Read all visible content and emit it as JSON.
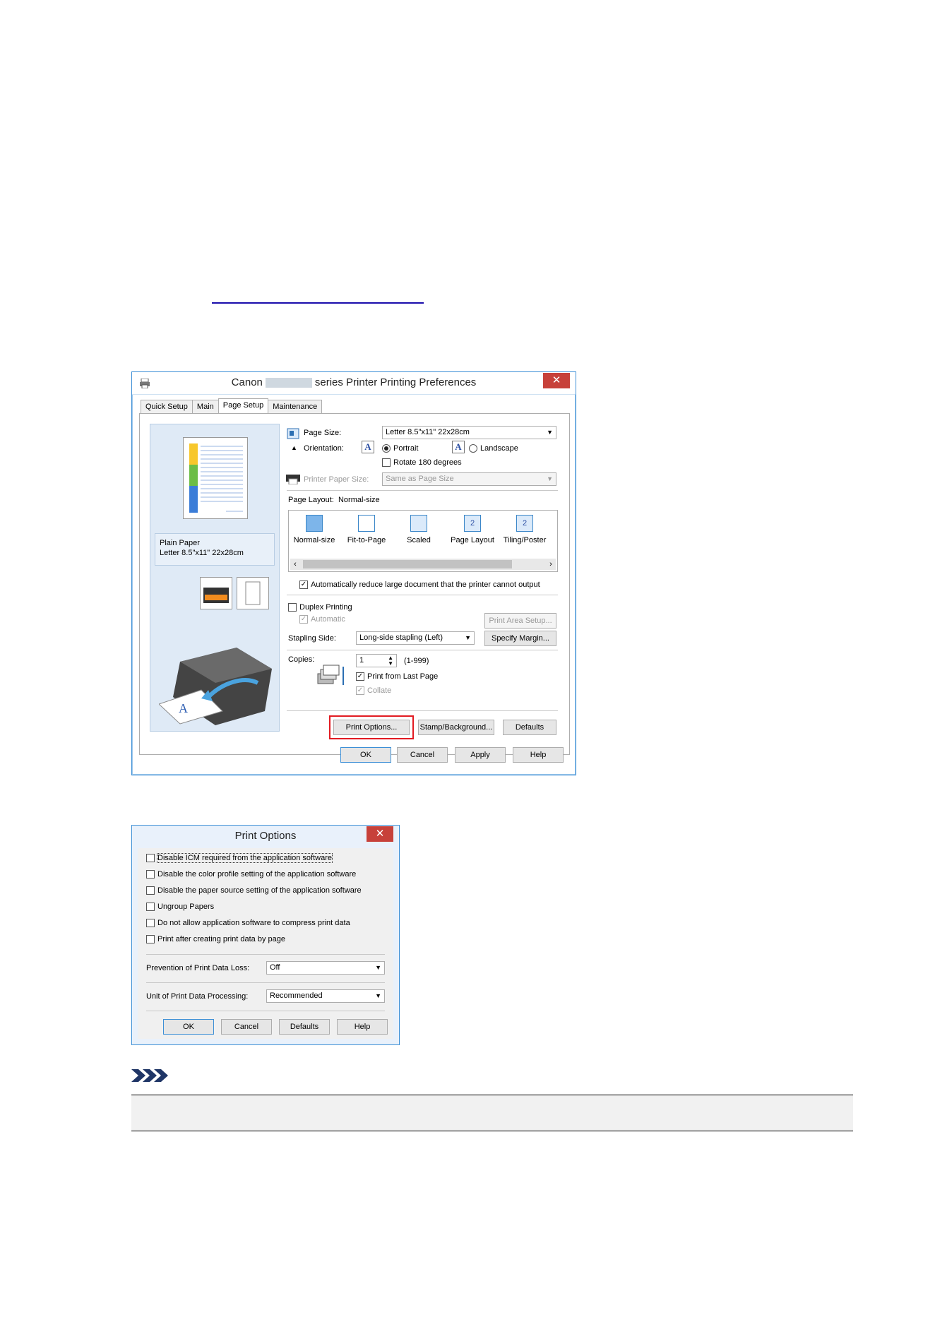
{
  "doc_link": "",
  "dialog1": {
    "title_prefix": "Canon",
    "title_suffix": "series Printer Printing Preferences",
    "close": "✕",
    "tabs": [
      "Quick Setup",
      "Main",
      "Page Setup",
      "Maintenance"
    ],
    "page_size_label": "Page Size:",
    "page_size_value": "Letter 8.5\"x11\" 22x28cm",
    "orientation_label": "Orientation:",
    "portrait": "Portrait",
    "landscape": "Landscape",
    "rotate": "Rotate 180 degrees",
    "printer_paper_size_label": "Printer Paper Size:",
    "printer_paper_size_value": "Same as Page Size",
    "page_layout_label": "Page Layout:",
    "page_layout_value": "Normal-size",
    "layouts": [
      "Normal-size",
      "Fit-to-Page",
      "Scaled",
      "Page Layout",
      "Tiling/Poster"
    ],
    "auto_reduce": "Automatically reduce large document that the printer cannot output",
    "duplex": "Duplex Printing",
    "automatic": "Automatic",
    "print_area_setup": "Print Area Setup...",
    "stapling_side_label": "Stapling Side:",
    "stapling_side_value": "Long-side stapling (Left)",
    "specify_margin": "Specify Margin...",
    "copies_label": "Copies:",
    "copies_value": "1",
    "copies_range": "(1-999)",
    "print_from_last": "Print from Last Page",
    "collate": "Collate",
    "paper_type": "Plain Paper",
    "paper_size": "Letter 8.5\"x11\" 22x28cm",
    "print_options": "Print Options...",
    "stamp_background": "Stamp/Background...",
    "defaults": "Defaults",
    "ok": "OK",
    "cancel": "Cancel",
    "apply": "Apply",
    "help": "Help"
  },
  "dialog2": {
    "title": "Print Options",
    "close": "✕",
    "options": [
      "Disable ICM required from the application software",
      "Disable the color profile setting of the application software",
      "Disable the paper source setting of the application software",
      "Ungroup Papers",
      "Do not allow application software to compress print data",
      "Print after creating print data by page"
    ],
    "prevention_label": "Prevention of Print Data Loss:",
    "prevention_value": "Off",
    "unit_label": "Unit of Print Data Processing:",
    "unit_value": "Recommended",
    "ok": "OK",
    "cancel": "Cancel",
    "defaults": "Defaults",
    "help": "Help"
  },
  "colors": {
    "highlight": "#e21b22",
    "close_button": "#c7413a",
    "accent": "#3c8fd6"
  }
}
